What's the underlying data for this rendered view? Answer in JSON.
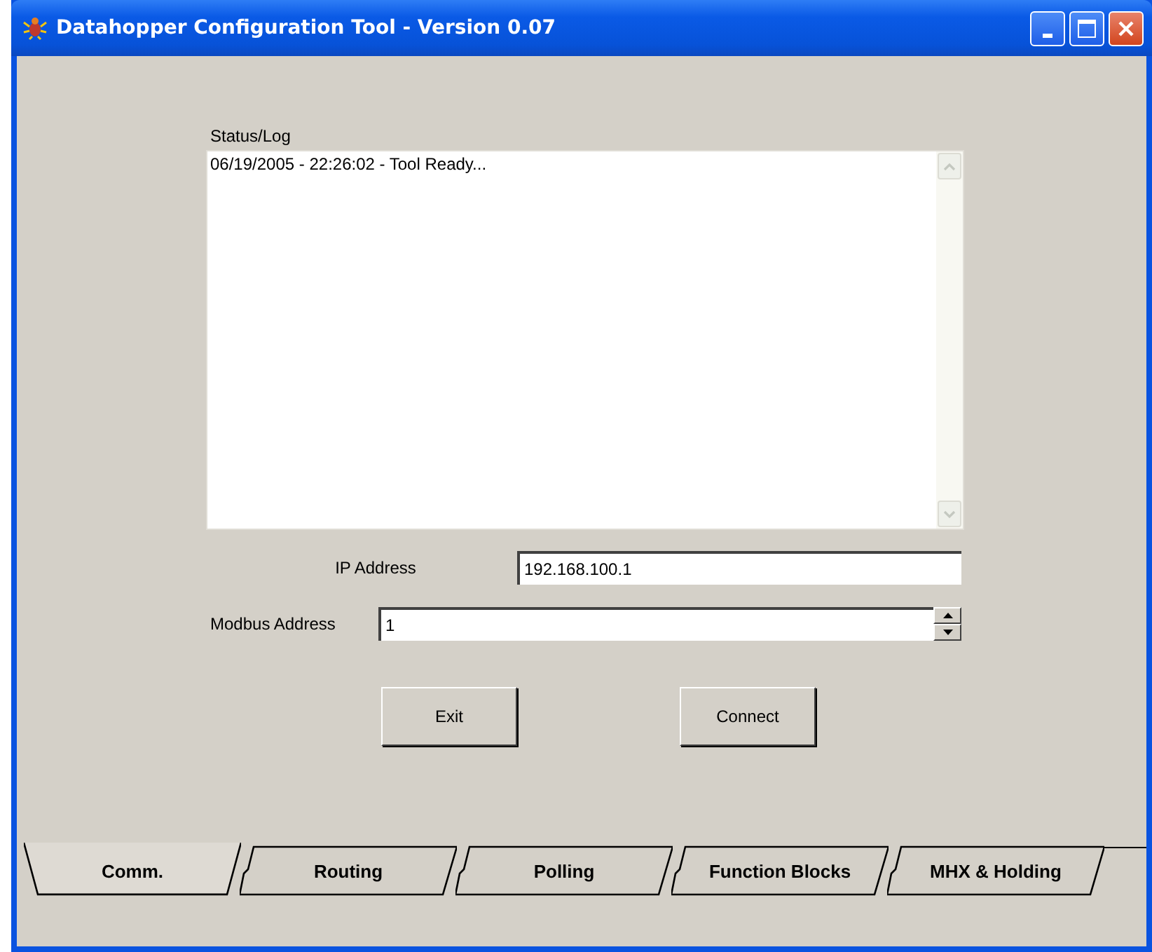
{
  "window": {
    "title": "Datahopper Configuration Tool - Version 0.07"
  },
  "status_log": {
    "label": "Status/Log",
    "lines": [
      "06/19/2005 - 22:26:02 - Tool Ready..."
    ]
  },
  "ip_address": {
    "label": "IP Address",
    "value": "192.168.100.1"
  },
  "modbus_address": {
    "label": "Modbus Address",
    "value": "1"
  },
  "buttons": [
    "Exit",
    "Connect"
  ],
  "tabs": [
    {
      "label": "Comm.",
      "selected": true
    },
    {
      "label": "Routing",
      "selected": false
    },
    {
      "label": "Polling",
      "selected": false
    },
    {
      "label": "Function Blocks",
      "selected": false
    },
    {
      "label": "MHX & Holding",
      "selected": false
    }
  ]
}
